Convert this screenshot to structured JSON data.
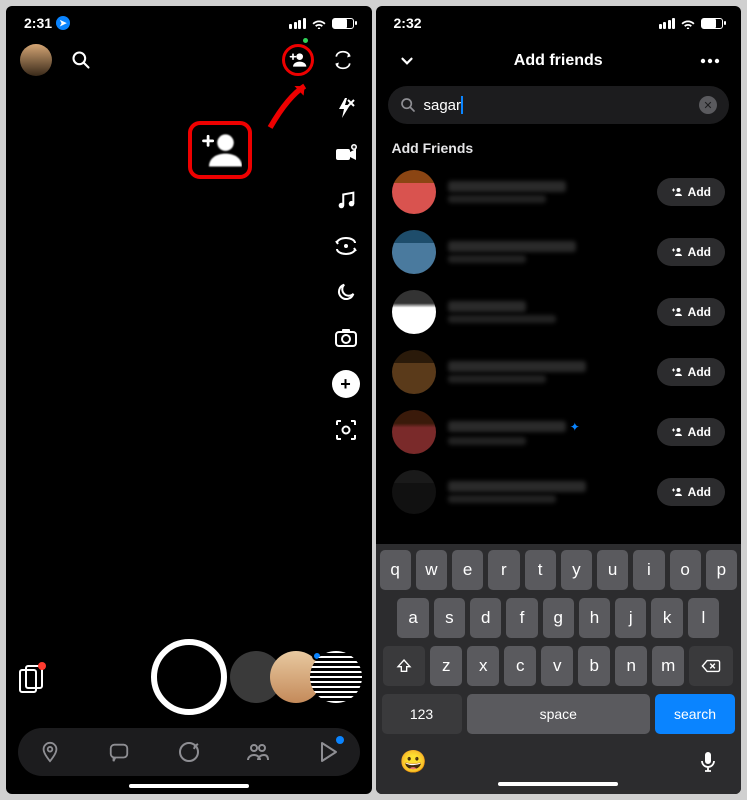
{
  "left": {
    "status_time": "2:31"
  },
  "right": {
    "status_time": "2:32",
    "header_title": "Add friends",
    "search_value": "sagar",
    "section_label": "Add Friends",
    "add_button_label": "Add",
    "keyboard": {
      "row1": [
        "q",
        "w",
        "e",
        "r",
        "t",
        "y",
        "u",
        "i",
        "o",
        "p"
      ],
      "row2": [
        "a",
        "s",
        "d",
        "f",
        "g",
        "h",
        "j",
        "k",
        "l"
      ],
      "row3": [
        "z",
        "x",
        "c",
        "v",
        "b",
        "n",
        "m"
      ],
      "key_123": "123",
      "key_space": "space",
      "key_search": "search"
    }
  }
}
